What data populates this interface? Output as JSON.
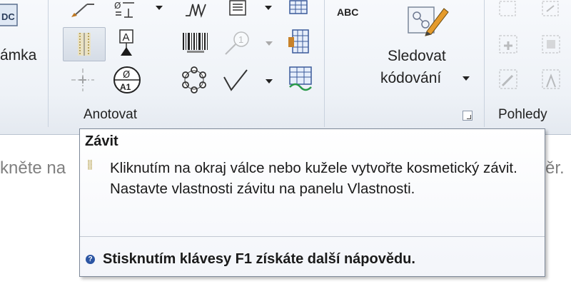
{
  "ribbon": {
    "left_partial_label": "ámka",
    "big_button_line1": "Sledovat",
    "big_button_line2": "kódování",
    "group_annotate": "Anotovat",
    "group_views": "Pohledy"
  },
  "icons": {
    "spell_check_text": "ABC",
    "partial_icon_text": "DC",
    "datum_letter": "A",
    "surface_finish_letters": "Ø\nA1",
    "balloon_number": "1"
  },
  "document": {
    "left_text": "kněte na",
    "right_text": "ěr."
  },
  "tooltip": {
    "title": "Závit",
    "body": "Kliknutím na okraj válce nebo kužele vytvořte kosmetický závit. Nastavte vlastnosti závitu na panelu Vlastnosti.",
    "help_text": "Stisknutím klávesy F1 získáte další nápovědu.",
    "help_icon": "?"
  }
}
